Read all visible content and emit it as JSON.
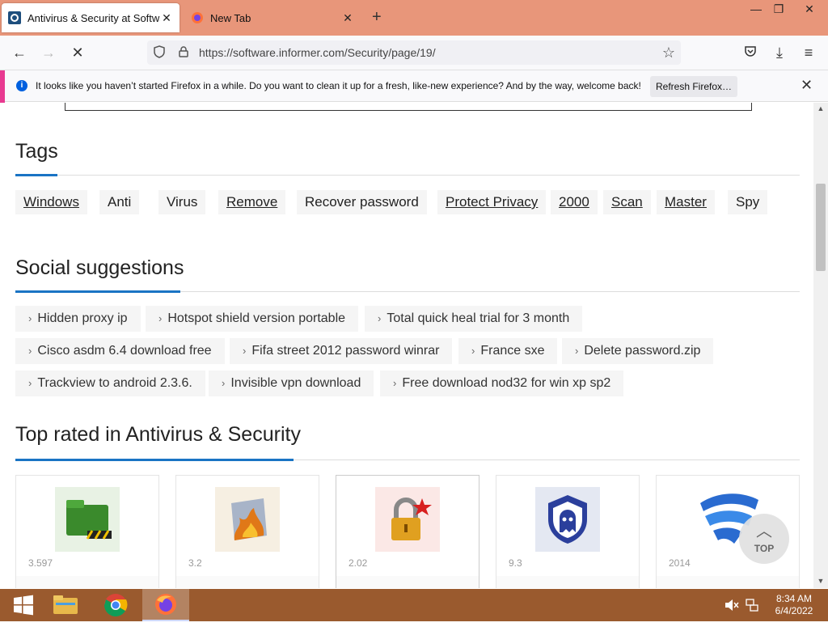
{
  "browser": {
    "tabs": [
      {
        "title": "Antivirus & Security at Software Informer",
        "favicon": "software-informer-icon"
      },
      {
        "title": "New Tab",
        "favicon": "firefox-icon"
      }
    ],
    "url": "https://software.informer.com/Security/page/19/",
    "window_controls": {
      "minimize": "—",
      "restore": "❐",
      "close": "✕"
    }
  },
  "notification": {
    "message": "It looks like you haven’t started Firefox in a while. Do you want to clean it up for a fresh, like-new experience? And by the way, welcome back!",
    "button_label": "Refresh Firefox…"
  },
  "tags_section": {
    "title": "Tags",
    "tags": [
      {
        "label": "Windows",
        "link": true
      },
      {
        "label": "Anti",
        "link": false
      },
      {
        "label": "Virus",
        "link": false
      },
      {
        "label": "Remove",
        "link": true
      },
      {
        "label": "Recover password",
        "link": false
      },
      {
        "label": "Protect Privacy",
        "link": true
      },
      {
        "label": "2000",
        "link": true
      },
      {
        "label": "Scan",
        "link": true
      },
      {
        "label": "Master",
        "link": true
      },
      {
        "label": "Spy",
        "link": false
      }
    ]
  },
  "social_section": {
    "title": "Social suggestions",
    "rows": [
      [
        "Hidden proxy ip",
        "Hotspot shield version portable",
        "Total quick heal trial for 3 month"
      ],
      [
        "Cisco asdm 6.4 download free",
        "Fifa street 2012 password winrar",
        "France sxe",
        "Delete password.zip"
      ],
      [
        "Trackview to android 2.3.6.",
        "Invisible vpn download",
        "Free download nod32 for win xp sp2"
      ]
    ]
  },
  "top_rated_section": {
    "title": "Top rated in Antivirus & Security",
    "cards": [
      {
        "version": "3.597",
        "icon": "green-folder-lock-icon",
        "bg": "#3a8a2c"
      },
      {
        "version": "3.2",
        "icon": "flame-shield-icon",
        "bg": "#e0a030"
      },
      {
        "version": "2.02",
        "icon": "padlock-star-icon",
        "bg": "#d83c3c"
      },
      {
        "version": "9.3",
        "icon": "ghost-shield-icon",
        "bg": "#2b3f9c"
      },
      {
        "version": "2014",
        "icon": "f-secure-logo-icon",
        "bg": "#2a6bd0"
      }
    ],
    "top_button": "TOP"
  },
  "taskbar": {
    "time": "8:34 AM",
    "date": "6/4/2022"
  }
}
